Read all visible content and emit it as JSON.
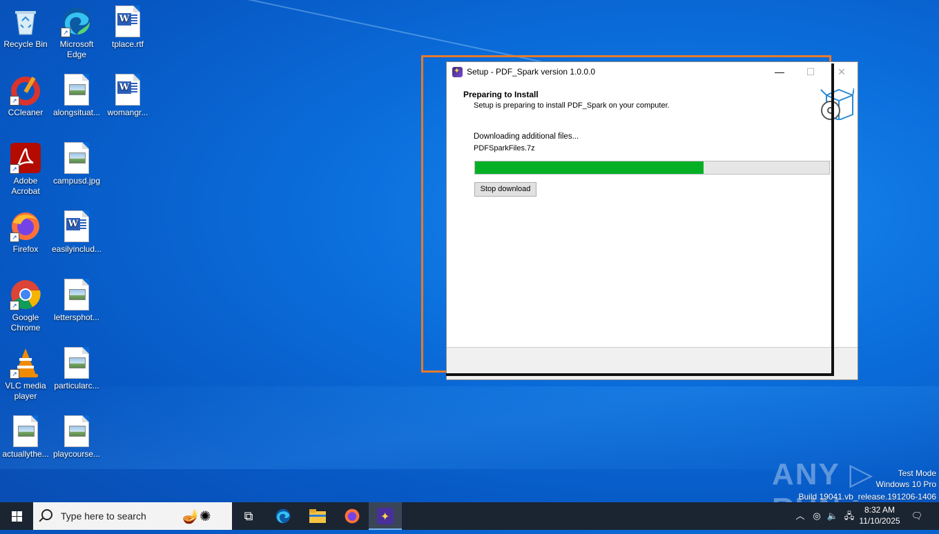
{
  "desktop": {
    "icons": [
      {
        "label": "Recycle Bin",
        "icon": "recycle-bin-icon"
      },
      {
        "label": "Microsoft Edge",
        "icon": "edge-icon"
      },
      {
        "label": "tplace.rtf",
        "icon": "word-doc-icon"
      },
      {
        "label": "CCleaner",
        "icon": "ccleaner-icon"
      },
      {
        "label": "alongsituat...",
        "icon": "image-file-icon"
      },
      {
        "label": "womangr...",
        "icon": "word-doc-icon"
      },
      {
        "label": "Adobe Acrobat",
        "icon": "acrobat-icon"
      },
      {
        "label": "campusd.jpg",
        "icon": "image-file-icon"
      },
      {
        "label": "Firefox",
        "icon": "firefox-icon"
      },
      {
        "label": "easilyinclud...",
        "icon": "word-doc-icon"
      },
      {
        "label": "Google Chrome",
        "icon": "chrome-icon"
      },
      {
        "label": "lettersphot...",
        "icon": "image-file-icon"
      },
      {
        "label": "VLC media player",
        "icon": "vlc-icon"
      },
      {
        "label": "particularc...",
        "icon": "image-file-icon"
      },
      {
        "label": "actuallythe...",
        "icon": "image-file-icon"
      },
      {
        "label": "playcourse...",
        "icon": "image-file-icon"
      }
    ]
  },
  "setup_window": {
    "title": "Setup - PDF_Spark version 1.0.0.0",
    "minimize": "—",
    "maximize": "☐",
    "close": "✕",
    "header_title": "Preparing to Install",
    "header_subtitle": "Setup is preparing to install PDF_Spark on your computer.",
    "status_line": "Downloading additional files...",
    "file_name": "PDFSparkFiles.7z",
    "progress": 0.645,
    "stop_button": "Stop download"
  },
  "watermark": {
    "brand": "ANY ▷ RUN",
    "line1": "Test Mode",
    "line2": "Windows 10 Pro",
    "line3": "Build 19041.vb_release.191206-1406"
  },
  "taskbar": {
    "search_placeholder": "Type here to search",
    "time": "8:32 AM",
    "date": "11/10/2025",
    "colors": {
      "background": "#1b2431",
      "progress_fill": "#06b025",
      "frame_orange": "#e87a2a"
    }
  }
}
